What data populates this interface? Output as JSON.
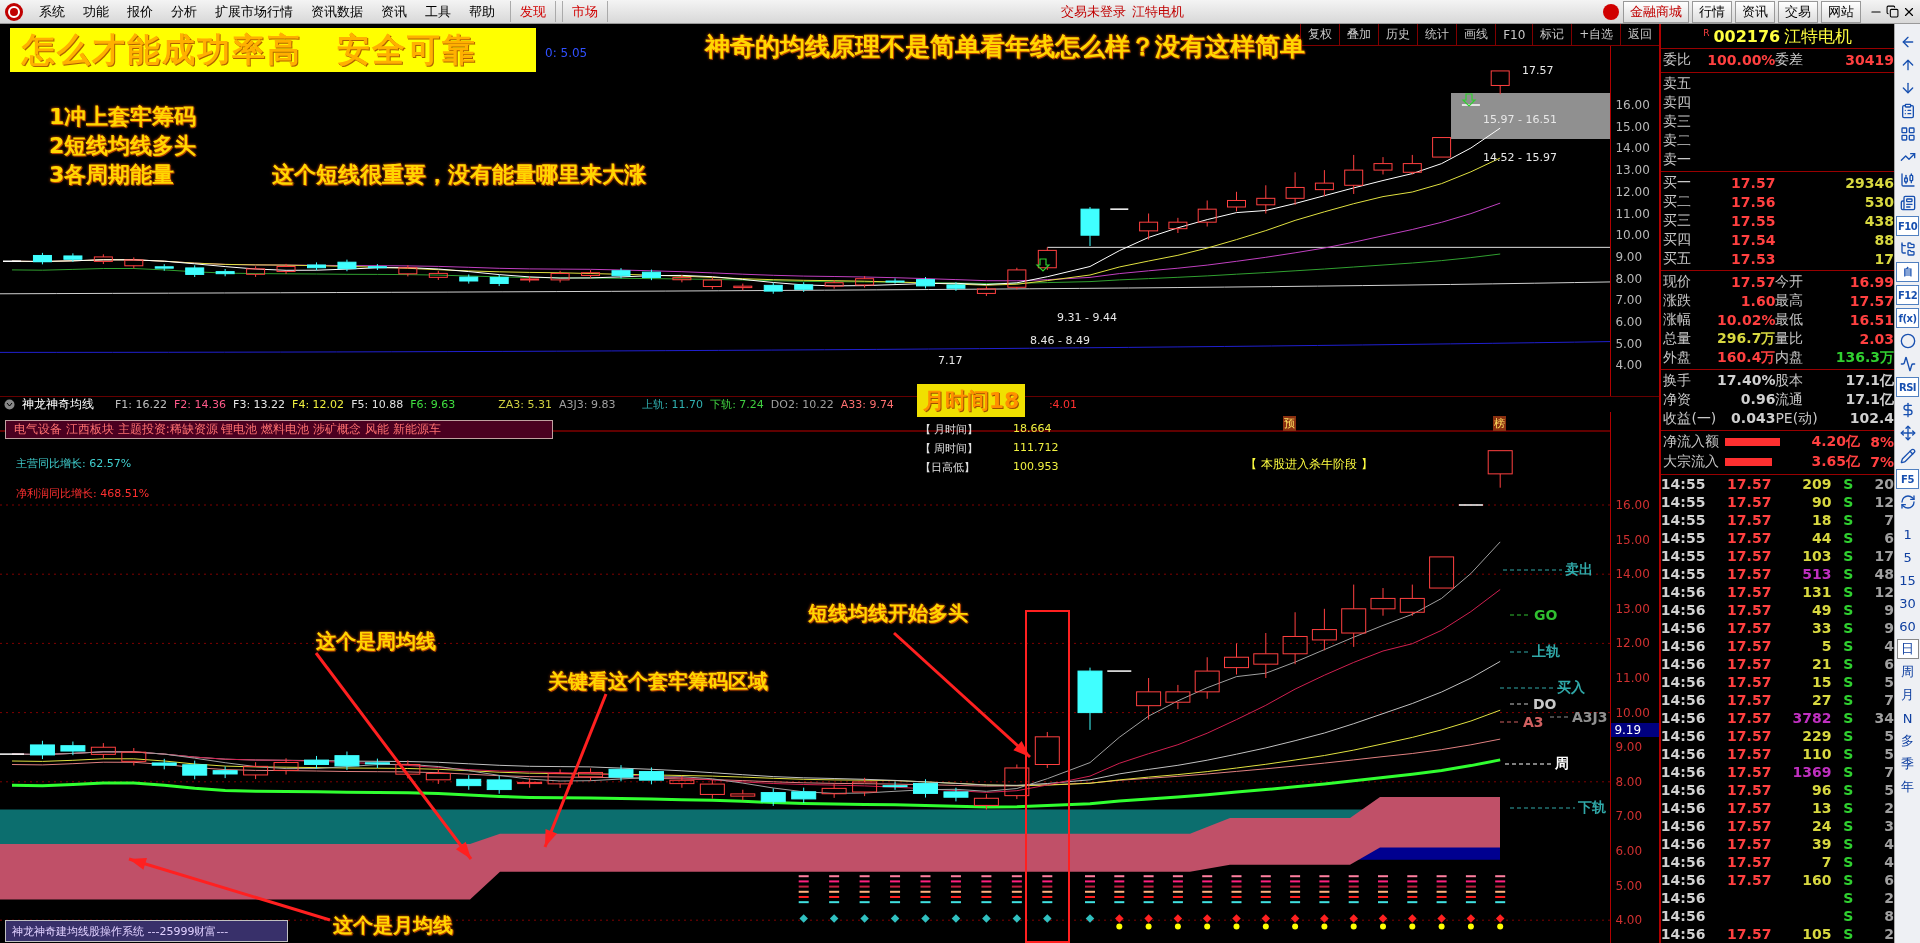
{
  "menu_bar": {
    "items": [
      {
        "label": "系统",
        "kind": "menu"
      },
      {
        "label": "功能",
        "kind": "menu"
      },
      {
        "label": "报价",
        "kind": "menu"
      },
      {
        "label": "分析",
        "kind": "menu"
      },
      {
        "label": "扩展市场行情",
        "kind": "menu"
      },
      {
        "label": "资讯数据",
        "kind": "menu"
      },
      {
        "label": "资讯",
        "kind": "menu"
      },
      {
        "label": "工具",
        "kind": "menu"
      },
      {
        "label": "帮助",
        "kind": "menu"
      },
      {
        "label": "发现",
        "kind": "tab"
      },
      {
        "label": "市场",
        "kind": "tab"
      }
    ],
    "status": [
      "交易未登录",
      "江特电机"
    ],
    "buttons": [
      "金融商城",
      "行情",
      "资讯",
      "交易",
      "网站"
    ]
  },
  "chart_toolbar": [
    "复权",
    "叠加",
    "历史",
    "统计",
    "画线",
    "F10",
    "标记",
    "+自选",
    "返回"
  ],
  "upper_chart": {
    "ma_readout": "0: 5.05",
    "banner": "怎么才能成功率高　安全可靠",
    "title": "神奇的均线原理不是简单看年线怎么样？没有这样简单",
    "notes": [
      "1冲上套牢筹码",
      "2短线均线多头",
      "3各周期能量"
    ],
    "remark": "这个短线很重要，没有能量哪里来大涨",
    "price_labels": [
      "17.57",
      "15.97 - 16.51",
      "14.52 - 15.97",
      "9.31 - 9.44",
      "8.46 - 8.49",
      "7.17"
    ],
    "axis": [
      "16.00",
      "15.00",
      "14.00",
      "13.00",
      "12.00",
      "11.00",
      "10.00",
      "9.00",
      "8.00",
      "7.00",
      "6.00",
      "5.00",
      "4.00"
    ]
  },
  "indicator": {
    "name": "神龙神奇均线",
    "readouts": [
      {
        "label": "F1: 16.22",
        "color": "#c0c0c0"
      },
      {
        "label": "F2: 14.36",
        "color": "#ff5a8a"
      },
      {
        "label": "F3: 13.22",
        "color": "#e8e8e8"
      },
      {
        "label": "F4: 12.02",
        "color": "#f0f040"
      },
      {
        "label": "F5: 10.88",
        "color": "#e0e0e0"
      },
      {
        "label": "F6: 9.63",
        "color": "#40e040"
      },
      {
        "label": "ZA3: 5.31",
        "color": "#d0d040"
      },
      {
        "label": "A3J3: 9.83",
        "color": "#a0a0a0"
      },
      {
        "label": "上轨: 11.70",
        "color": "#30b0b0"
      },
      {
        "label": "下轨: 7.24",
        "color": "#40d040"
      },
      {
        "label": "DO2: 10.22",
        "color": "#a0a0a0"
      },
      {
        "label": "A33: 9.74",
        "color": "#ff7070"
      }
    ],
    "badge": "月时间18",
    "tail": ":4.01",
    "markers": [
      "预",
      "榜"
    ]
  },
  "lower_chart": {
    "sectors": "电气设备 江西板块 主题投资:稀缺资源 锂电池 燃料电池 涉矿概念 风能 新能源车",
    "growth": [
      {
        "label": "主营同比增长: 62.57%",
        "color": "#40d0d0"
      },
      {
        "label": "净利润同比增长: 468.51%",
        "color": "#ff3030"
      }
    ],
    "times": [
      {
        "label": "【 月时间】",
        "value": "18.664"
      },
      {
        "label": "【 周时间】",
        "value": "111.712"
      },
      {
        "label": "【日高低】",
        "value": "100.953"
      }
    ],
    "signal": "【 本股进入杀牛阶段 】",
    "annotations": [
      "短线均线开始多头",
      "这个是周均线",
      "关键看这个套牢筹码区域",
      "这个是月均线"
    ],
    "line_labels": [
      {
        "text": "卖出",
        "color": "#30a8a8"
      },
      {
        "text": "GO",
        "color": "#30c030"
      },
      {
        "text": "上轨",
        "color": "#30a8a8"
      },
      {
        "text": "买入",
        "color": "#30a8a8"
      },
      {
        "text": "DO",
        "color": "#c8c8c8"
      },
      {
        "text": "A3J3",
        "color": "#909090"
      },
      {
        "text": "A3",
        "color": "#d06060"
      },
      {
        "text": "周",
        "color": "#ffffff"
      },
      {
        "text": "下轨",
        "color": "#30a8a8"
      }
    ],
    "axis": [
      "16.00",
      "15.00",
      "14.00",
      "13.00",
      "12.00",
      "11.00",
      "10.00",
      "9.00",
      "8.00",
      "7.00",
      "6.00",
      "5.00",
      "4.00"
    ],
    "last_price": "9.19",
    "footer": "神龙神奇建均线股操作系统 ---25999财富---"
  },
  "quote": {
    "flag": "R",
    "code": "002176",
    "name": "江特电机",
    "ratio": [
      {
        "label": "委比",
        "value": "100.00%"
      },
      {
        "label": "委差",
        "value": "30419"
      }
    ],
    "asks": [
      "卖五",
      "卖四",
      "卖三",
      "卖二",
      "卖一"
    ],
    "bids": [
      {
        "label": "买一",
        "price": "17.57",
        "volume": "29346"
      },
      {
        "label": "买二",
        "price": "17.56",
        "volume": "530"
      },
      {
        "label": "买三",
        "price": "17.55",
        "volume": "438"
      },
      {
        "label": "买四",
        "price": "17.54",
        "volume": "88"
      },
      {
        "label": "买五",
        "price": "17.53",
        "volume": "17"
      }
    ],
    "stats": [
      {
        "label": "现价",
        "value": "17.57",
        "color": "#ff4040"
      },
      {
        "label": "今开",
        "value": "16.99",
        "color": "#ff4040"
      },
      {
        "label": "涨跌",
        "value": "1.60",
        "color": "#ff4040"
      },
      {
        "label": "最高",
        "value": "17.57",
        "color": "#ff4040"
      },
      {
        "label": "涨幅",
        "value": "10.02%",
        "color": "#ff4040"
      },
      {
        "label": "最低",
        "value": "16.51",
        "color": "#ff4040"
      },
      {
        "label": "总量",
        "value": "296.7万",
        "color": "#d8d840"
      },
      {
        "label": "量比",
        "value": "2.03",
        "color": "#ff4040"
      },
      {
        "label": "外盘",
        "value": "160.4万",
        "color": "#ff4040"
      },
      {
        "label": "内盘",
        "value": "136.3万",
        "color": "#30d030"
      }
    ],
    "capital": [
      {
        "label": "换手",
        "value": "17.40%"
      },
      {
        "label": "股本",
        "value": "17.1亿"
      },
      {
        "label": "净资",
        "value": "0.96"
      },
      {
        "label": "流通",
        "value": "17.1亿"
      },
      {
        "label": "收益(一)",
        "value": "0.043"
      },
      {
        "label": "PE(动)",
        "value": "102.4"
      }
    ],
    "flows": [
      {
        "label": "净流入额",
        "amount": "4.20亿",
        "share": "8%"
      },
      {
        "label": "大宗流入",
        "amount": "3.65亿",
        "share": "7%"
      }
    ],
    "ticks": [
      {
        "time": "14:55",
        "price": "17.57",
        "volume": "209",
        "color": "#d8d840",
        "side": "S",
        "count": "20"
      },
      {
        "time": "14:55",
        "price": "17.57",
        "volume": "90",
        "color": "#d8d840",
        "side": "S",
        "count": "12"
      },
      {
        "time": "14:55",
        "price": "17.57",
        "volume": "18",
        "color": "#d8d840",
        "side": "S",
        "count": "7"
      },
      {
        "time": "14:55",
        "price": "17.57",
        "volume": "44",
        "color": "#d8d840",
        "side": "S",
        "count": "6"
      },
      {
        "time": "14:55",
        "price": "17.57",
        "volume": "103",
        "color": "#d8d840",
        "side": "S",
        "count": "17"
      },
      {
        "time": "14:55",
        "price": "17.57",
        "volume": "513",
        "color": "#c030c0",
        "side": "S",
        "count": "48"
      },
      {
        "time": "14:56",
        "price": "17.57",
        "volume": "131",
        "color": "#d8d840",
        "side": "S",
        "count": "12"
      },
      {
        "time": "14:56",
        "price": "17.57",
        "volume": "49",
        "color": "#d8d840",
        "side": "S",
        "count": "9"
      },
      {
        "time": "14:56",
        "price": "17.57",
        "volume": "33",
        "color": "#d8d840",
        "side": "S",
        "count": "9"
      },
      {
        "time": "14:56",
        "price": "17.57",
        "volume": "5",
        "color": "#d8d840",
        "side": "S",
        "count": "4"
      },
      {
        "time": "14:56",
        "price": "17.57",
        "volume": "21",
        "color": "#d8d840",
        "side": "S",
        "count": "6"
      },
      {
        "time": "14:56",
        "price": "17.57",
        "volume": "15",
        "color": "#d8d840",
        "side": "S",
        "count": "5"
      },
      {
        "time": "14:56",
        "price": "17.57",
        "volume": "27",
        "color": "#d8d840",
        "side": "S",
        "count": "7"
      },
      {
        "time": "14:56",
        "price": "17.57",
        "volume": "3782",
        "color": "#c030c0",
        "side": "S",
        "count": "34"
      },
      {
        "time": "14:56",
        "price": "17.57",
        "volume": "229",
        "color": "#d8d840",
        "side": "S",
        "count": "5"
      },
      {
        "time": "14:56",
        "price": "17.57",
        "volume": "110",
        "color": "#d8d840",
        "side": "S",
        "count": "5"
      },
      {
        "time": "14:56",
        "price": "17.57",
        "volume": "1369",
        "color": "#c030c0",
        "side": "S",
        "count": "7"
      },
      {
        "time": "14:56",
        "price": "17.57",
        "volume": "96",
        "color": "#d8d840",
        "side": "S",
        "count": "5"
      },
      {
        "time": "14:56",
        "price": "17.57",
        "volume": "13",
        "color": "#d8d840",
        "side": "S",
        "count": "2"
      },
      {
        "time": "14:56",
        "price": "17.57",
        "volume": "24",
        "color": "#d8d840",
        "side": "S",
        "count": "3"
      },
      {
        "time": "14:56",
        "price": "17.57",
        "volume": "39",
        "color": "#d8d840",
        "side": "S",
        "count": "4"
      },
      {
        "time": "14:56",
        "price": "17.57",
        "volume": "7",
        "color": "#d8d840",
        "side": "S",
        "count": "4"
      },
      {
        "time": "14:56",
        "price": "17.57",
        "volume": "160",
        "color": "#d8d840",
        "side": "S",
        "count": "6"
      },
      {
        "time": "14:56",
        "side": "S",
        "count": "2"
      },
      {
        "time": "14:56",
        "side": "S",
        "count": "8"
      },
      {
        "time": "14:56",
        "price": "17.57",
        "volume": "105",
        "color": "#d8d840",
        "side": "S",
        "count": "2"
      }
    ]
  },
  "side_strip": {
    "tools": [
      {
        "kind": "arrow-left"
      },
      {
        "kind": "arrow-up"
      },
      {
        "kind": "arrow-down"
      },
      {
        "kind": "report"
      },
      {
        "kind": "grid"
      },
      {
        "kind": "trend"
      },
      {
        "kind": "candles"
      },
      {
        "kind": "news"
      },
      {
        "kind": "label",
        "label": "F10"
      },
      {
        "kind": "tree"
      },
      {
        "kind": "label",
        "label": "自"
      },
      {
        "kind": "label",
        "label": "F12"
      },
      {
        "kind": "label",
        "label": "f(x)"
      },
      {
        "kind": "circle"
      },
      {
        "kind": "wave"
      },
      {
        "kind": "label",
        "label": "RSI"
      },
      {
        "kind": "dollar"
      },
      {
        "kind": "move"
      },
      {
        "kind": "pencil"
      },
      {
        "kind": "label",
        "label": "F5"
      },
      {
        "kind": "refresh"
      }
    ],
    "periods": [
      {
        "label": "1",
        "selected": false
      },
      {
        "label": "5",
        "selected": false
      },
      {
        "label": "15",
        "selected": false
      },
      {
        "label": "30",
        "selected": false
      },
      {
        "label": "60",
        "selected": false
      },
      {
        "label": "日",
        "selected": true
      },
      {
        "label": "周",
        "selected": false
      },
      {
        "label": "月",
        "selected": false
      },
      {
        "label": "N",
        "selected": false
      },
      {
        "label": "多",
        "selected": false
      },
      {
        "label": "季",
        "selected": false
      },
      {
        "label": "年",
        "selected": false
      }
    ]
  }
}
